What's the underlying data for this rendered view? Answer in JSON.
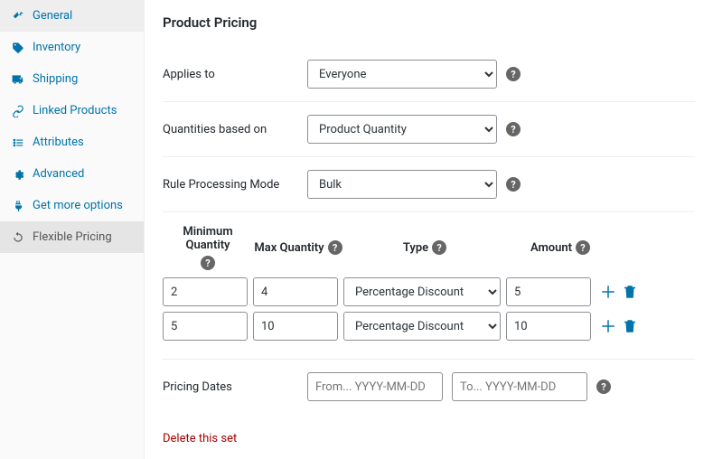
{
  "sidebar": {
    "items": [
      {
        "label": "General",
        "icon": "wrench"
      },
      {
        "label": "Inventory",
        "icon": "tag"
      },
      {
        "label": "Shipping",
        "icon": "truck"
      },
      {
        "label": "Linked Products",
        "icon": "link"
      },
      {
        "label": "Attributes",
        "icon": "list"
      },
      {
        "label": "Advanced",
        "icon": "gear"
      },
      {
        "label": "Get more options",
        "icon": "plug"
      },
      {
        "label": "Flexible Pricing",
        "icon": "refresh",
        "active": true
      }
    ]
  },
  "main": {
    "title": "Product Pricing",
    "applies_to": {
      "label": "Applies to",
      "value": "Everyone"
    },
    "quantities_based_on": {
      "label": "Quantities based on",
      "value": "Product Quantity"
    },
    "rule_mode": {
      "label": "Rule Processing Mode",
      "value": "Bulk"
    },
    "rules": {
      "headers": {
        "min": "Minimum Quantity",
        "max": "Max Quantity",
        "type": "Type",
        "amount": "Amount"
      },
      "rows": [
        {
          "min": "2",
          "max": "4",
          "type": "Percentage Discount",
          "amount": "5"
        },
        {
          "min": "5",
          "max": "10",
          "type": "Percentage Discount",
          "amount": "10"
        }
      ]
    },
    "pricing_dates": {
      "label": "Pricing Dates",
      "from_placeholder": "From... YYYY-MM-DD",
      "to_placeholder": "To... YYYY-MM-DD"
    },
    "delete_label": "Delete this set"
  }
}
